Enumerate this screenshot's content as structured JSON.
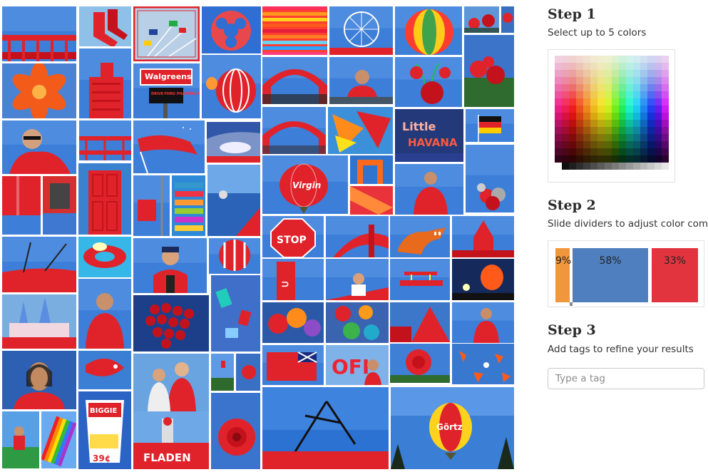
{
  "steps": {
    "step1": {
      "title": "Step 1",
      "description": "Select up to 5 colors"
    },
    "step2": {
      "title": "Step 2",
      "description": "Slide dividers to adjust color com"
    },
    "step3": {
      "title": "Step 3",
      "description": "Add tags to refine your results"
    }
  },
  "tag_input": {
    "placeholder": "Type a tag",
    "value": ""
  },
  "color_mix": [
    {
      "label": "9%",
      "fraction": 0.09,
      "color": "#f0963c"
    },
    {
      "label": "58%",
      "fraction": 0.58,
      "color": "#4f7fbf"
    },
    {
      "label": "33%",
      "fraction": 0.33,
      "color": "#e2343e"
    }
  ],
  "photo_text": {
    "walgreens_sign": "Walgreens",
    "walgreens_sub": "DRIVE-THRU PHARMACY",
    "little_havana_sign": "Little HAVANA",
    "virgin_balloon": "Virgin",
    "stop_sign": "STOP",
    "biggie_bag": "BIGGIE",
    "biggie_price": "39¢",
    "fladen_ship": "FLADEN",
    "gortz_balloon": "Görtz",
    "ofi_sign": "OFI"
  }
}
